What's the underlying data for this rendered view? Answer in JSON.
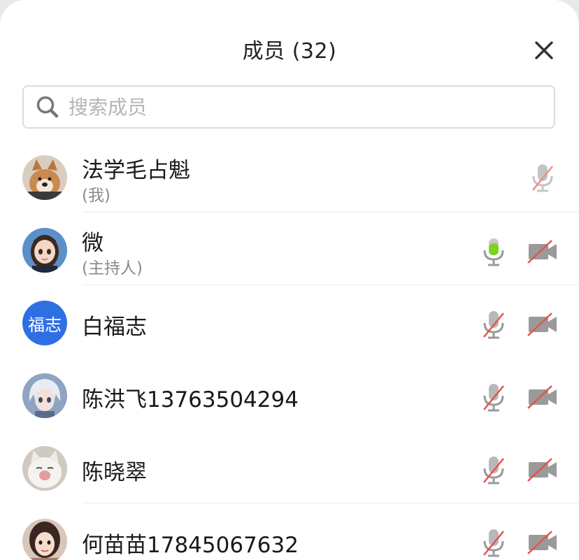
{
  "header": {
    "title": "成员 (32)"
  },
  "search": {
    "placeholder": "搜索成员"
  },
  "members": [
    {
      "name": "法学毛占魁",
      "role": "(我)",
      "avatar": "shiba-dog-photo",
      "mic": "muted",
      "camera": "none"
    },
    {
      "name": "微",
      "role": "(主持人)",
      "avatar": "cartoon-girl-photo",
      "mic": "active",
      "camera": "off"
    },
    {
      "name": "白福志",
      "role": "",
      "avatar_text": "福志",
      "avatar": "text-avatar",
      "mic": "muted",
      "camera": "off"
    },
    {
      "name": "陈洪飞13763504294",
      "role": "",
      "avatar": "anime-character-photo",
      "mic": "muted",
      "camera": "off"
    },
    {
      "name": "陈晓翠",
      "role": "",
      "avatar": "cat-photo",
      "mic": "muted",
      "camera": "off"
    },
    {
      "name": "何苗苗17845067632",
      "role": "",
      "avatar": "woman-portrait-photo",
      "mic": "muted",
      "camera": "off"
    }
  ],
  "colors": {
    "mic_active": "#7ed321",
    "muted_slash": "#e4534d",
    "icon_gray": "#9a9a9a",
    "text_avatar_bg": "#2f6fe4"
  }
}
